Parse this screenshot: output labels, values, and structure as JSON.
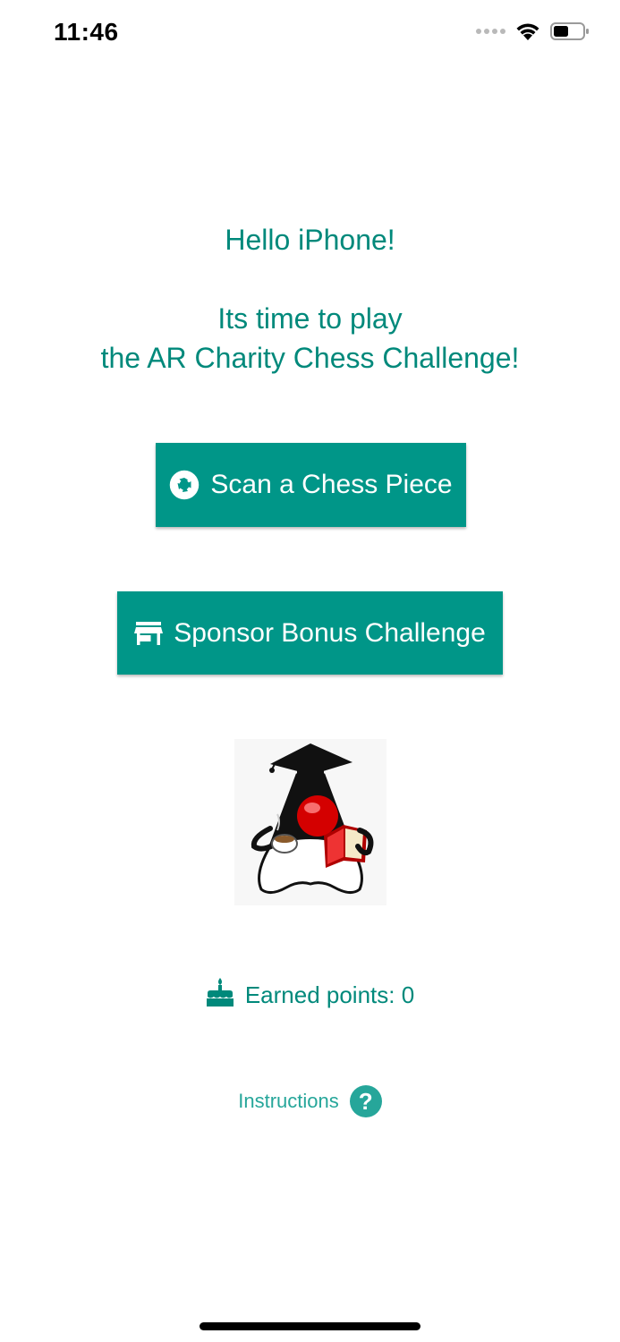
{
  "status_bar": {
    "time": "11:46"
  },
  "greeting": {
    "hello": "Hello iPhone!",
    "line1": "Its time to play",
    "line2": "the AR Charity Chess Challenge!"
  },
  "buttons": {
    "scan_label": "Scan a Chess Piece",
    "scan_icon": "camera-aperture-icon",
    "sponsor_label": "Sponsor Bonus Challenge",
    "sponsor_icon": "store-icon"
  },
  "mascot": {
    "icon": "java-duke-mascot"
  },
  "points": {
    "label": "Earned points: 0",
    "icon": "cake-icon"
  },
  "instructions": {
    "label": "Instructions",
    "icon": "help-circle-icon"
  },
  "colors": {
    "primary": "#009688",
    "text_accent": "#00897b",
    "link": "#26a69a",
    "background": "#ffffff"
  }
}
